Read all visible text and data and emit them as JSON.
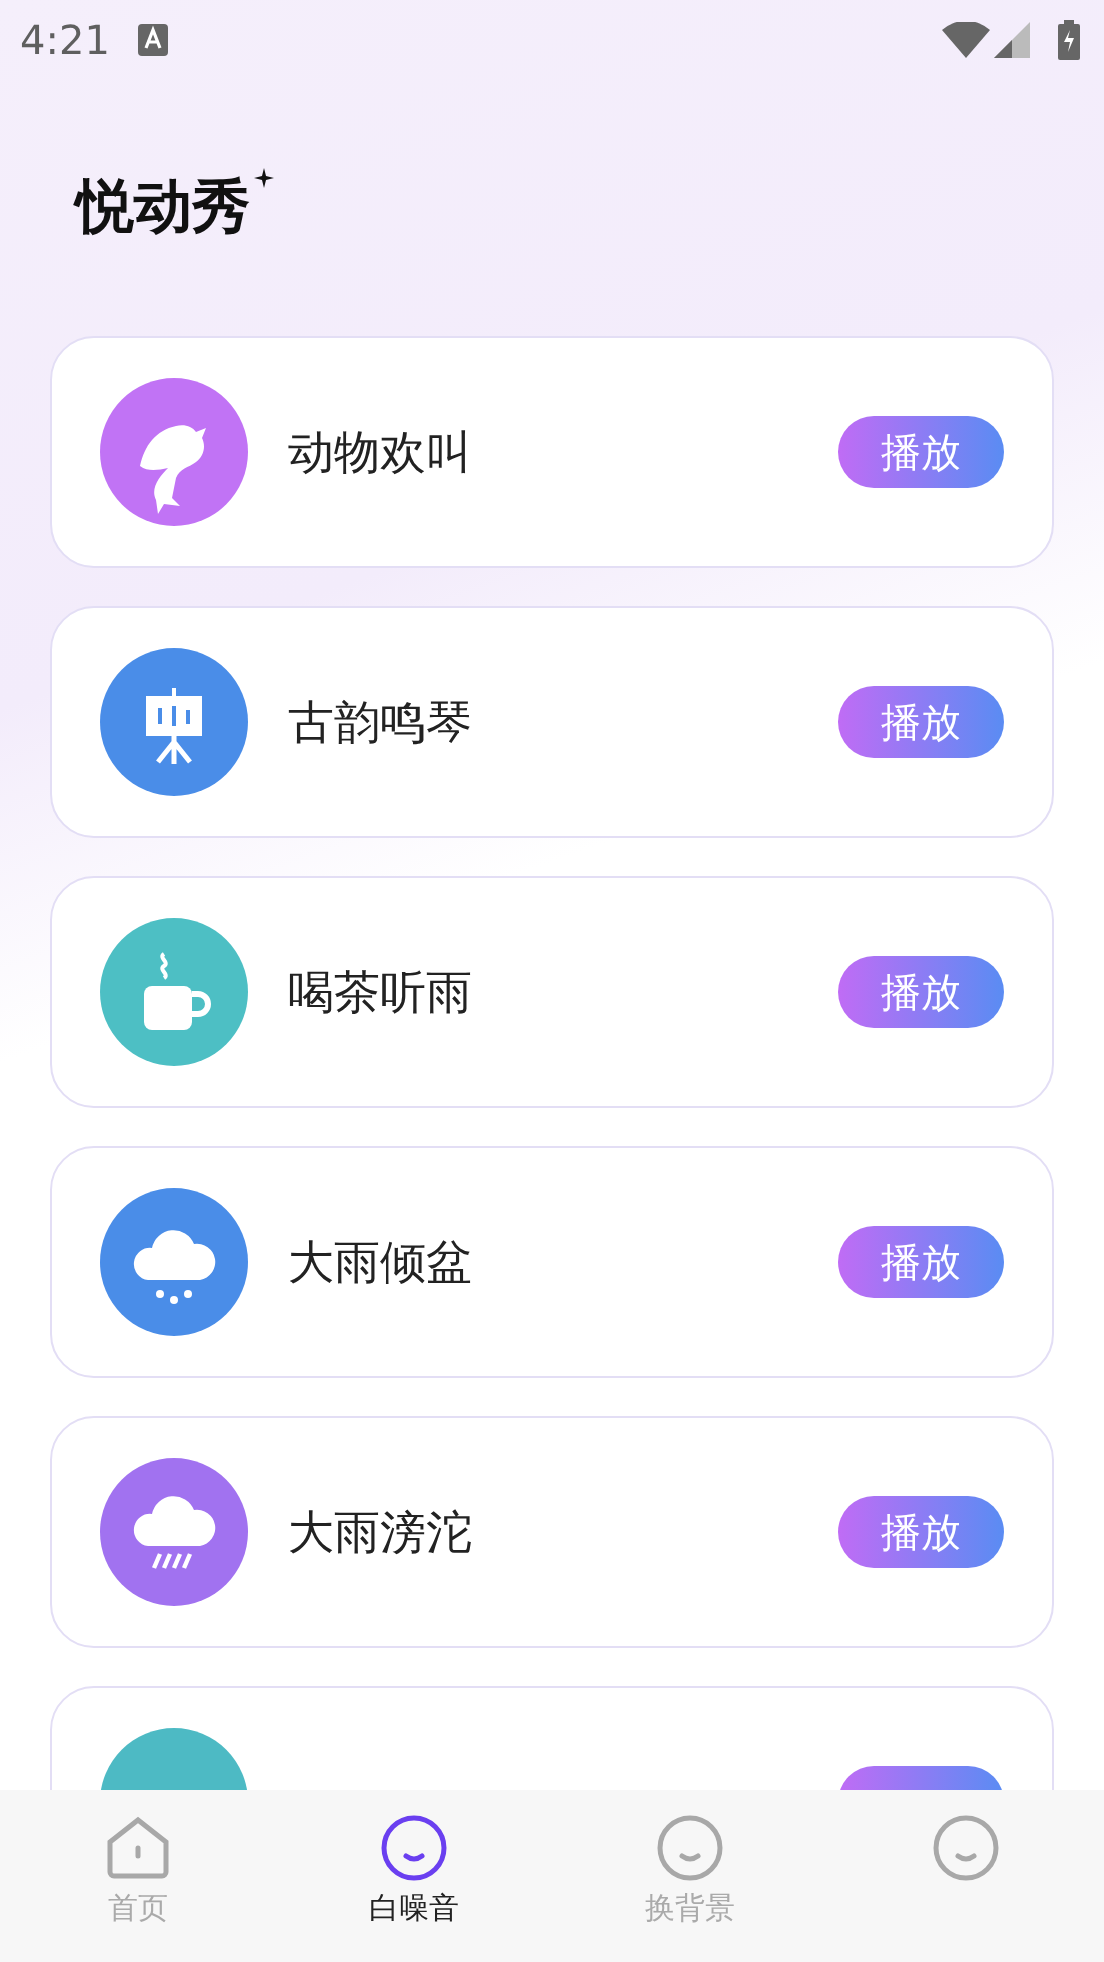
{
  "status_bar": {
    "time": "4:21"
  },
  "title": "悦动秀",
  "sounds": [
    {
      "name": "动物欢叫",
      "color": "#c173f5",
      "action": "播放"
    },
    {
      "name": "古韵鸣琴",
      "color": "#4a8de8",
      "action": "播放"
    },
    {
      "name": "喝茶听雨",
      "color": "#4dbfc4",
      "action": "播放"
    },
    {
      "name": "大雨倾盆",
      "color": "#4a8de8",
      "action": "播放"
    },
    {
      "name": "大雨滂沱",
      "color": "#a172f0",
      "action": "播放"
    },
    {
      "color": "#4dbac4"
    }
  ],
  "nav": [
    {
      "label": "首页",
      "selected": false
    },
    {
      "label": "白噪音",
      "selected": true
    },
    {
      "label": "换背景",
      "selected": false
    },
    {
      "selected": false
    }
  ]
}
